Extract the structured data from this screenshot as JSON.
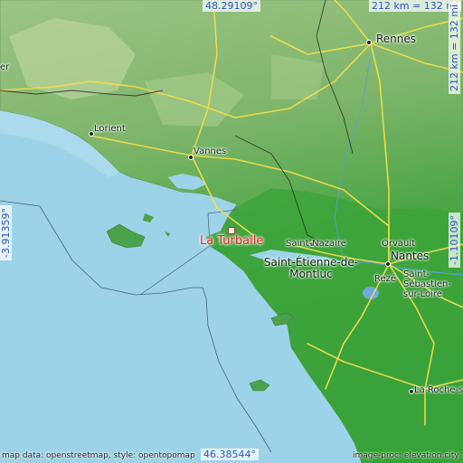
{
  "map": {
    "highlight_place": "La Turballe",
    "coordinates": {
      "north": "48.29109°",
      "south": "46.38544°",
      "west": "-3.91359°",
      "east": "-1.10109°"
    },
    "scale": {
      "top": "212 km = 132 mi",
      "right": "212 km = 132 mi"
    },
    "cities": [
      {
        "name": "Rennes",
        "key": "rennes"
      },
      {
        "name": "Lorient",
        "key": "lorient"
      },
      {
        "name": "Vannes",
        "key": "vannes"
      },
      {
        "name": "Saint-Nazaire",
        "key": "saint-nazaire"
      },
      {
        "name": "Saint-Étienne-de-Montluc",
        "key": "saint-etienne"
      },
      {
        "name": "Orvault",
        "key": "orvault"
      },
      {
        "name": "Nantes",
        "key": "nantes"
      },
      {
        "name": "Rezé",
        "key": "reze"
      },
      {
        "name": "Saint-Sébastien-sur-Loire",
        "key": "saint-sebastien"
      },
      {
        "name": "La Roche-sur",
        "key": "la-roche"
      },
      {
        "name": "er",
        "key": "edge-west"
      }
    ],
    "attribution_left": "map data: openstreetmap, style: opentopomap",
    "attribution_right": "image-proc: elevation.city",
    "colors": {
      "sea": "#9dd3e8",
      "lowland": "#3f9f3f",
      "upland": "#a4c98a",
      "roads": "#f3e15b",
      "highlight": "#e8201c",
      "coord_text": "#2a56c8"
    }
  }
}
